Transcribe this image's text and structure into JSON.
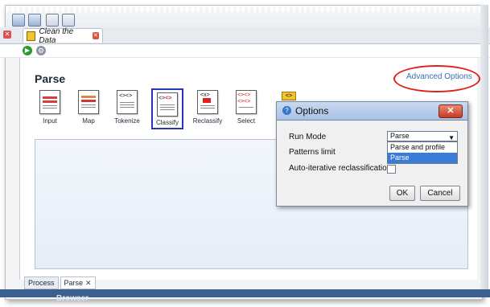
{
  "document_tab": {
    "label": "Clean the Data"
  },
  "page": {
    "title": "Parse",
    "advanced_options": "Advanced Options"
  },
  "tools": [
    {
      "label": "Input"
    },
    {
      "label": "Map"
    },
    {
      "label": "Tokenize"
    },
    {
      "label": "Classify",
      "selected": true
    },
    {
      "label": "Reclassify"
    },
    {
      "label": "Select"
    }
  ],
  "badge": {
    "text": "<>"
  },
  "dialog": {
    "title": "Options",
    "run_mode_label": "Run Mode",
    "run_mode_value": "Parse",
    "options": [
      "Parse and profile",
      "Parse"
    ],
    "patterns_limit_label": "Patterns limit",
    "auto_reclass_label": "Auto-iterative reclassification",
    "ok_label": "OK",
    "cancel_label": "Cancel"
  },
  "bottom_tabs": [
    "Process",
    "Parse"
  ],
  "footer": {
    "browser": "Browser"
  },
  "colors": {
    "highlight": "#e0201a",
    "link": "#3b6fb6",
    "selection": "#3a7bd5"
  }
}
